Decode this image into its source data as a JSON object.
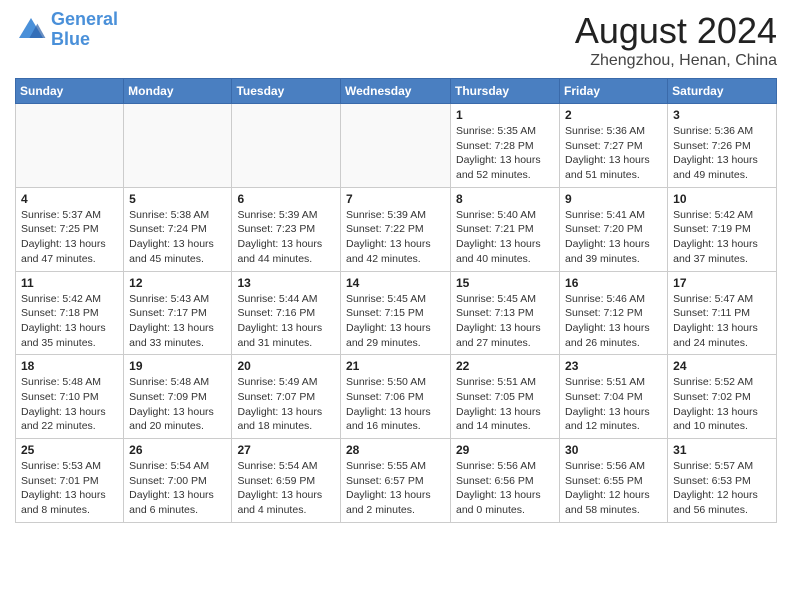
{
  "logo": {
    "line1": "General",
    "line2": "Blue"
  },
  "title": "August 2024",
  "subtitle": "Zhengzhou, Henan, China",
  "days_of_week": [
    "Sunday",
    "Monday",
    "Tuesday",
    "Wednesday",
    "Thursday",
    "Friday",
    "Saturday"
  ],
  "weeks": [
    [
      {
        "day": "",
        "info": ""
      },
      {
        "day": "",
        "info": ""
      },
      {
        "day": "",
        "info": ""
      },
      {
        "day": "",
        "info": ""
      },
      {
        "day": "1",
        "info": "Sunrise: 5:35 AM\nSunset: 7:28 PM\nDaylight: 13 hours\nand 52 minutes."
      },
      {
        "day": "2",
        "info": "Sunrise: 5:36 AM\nSunset: 7:27 PM\nDaylight: 13 hours\nand 51 minutes."
      },
      {
        "day": "3",
        "info": "Sunrise: 5:36 AM\nSunset: 7:26 PM\nDaylight: 13 hours\nand 49 minutes."
      }
    ],
    [
      {
        "day": "4",
        "info": "Sunrise: 5:37 AM\nSunset: 7:25 PM\nDaylight: 13 hours\nand 47 minutes."
      },
      {
        "day": "5",
        "info": "Sunrise: 5:38 AM\nSunset: 7:24 PM\nDaylight: 13 hours\nand 45 minutes."
      },
      {
        "day": "6",
        "info": "Sunrise: 5:39 AM\nSunset: 7:23 PM\nDaylight: 13 hours\nand 44 minutes."
      },
      {
        "day": "7",
        "info": "Sunrise: 5:39 AM\nSunset: 7:22 PM\nDaylight: 13 hours\nand 42 minutes."
      },
      {
        "day": "8",
        "info": "Sunrise: 5:40 AM\nSunset: 7:21 PM\nDaylight: 13 hours\nand 40 minutes."
      },
      {
        "day": "9",
        "info": "Sunrise: 5:41 AM\nSunset: 7:20 PM\nDaylight: 13 hours\nand 39 minutes."
      },
      {
        "day": "10",
        "info": "Sunrise: 5:42 AM\nSunset: 7:19 PM\nDaylight: 13 hours\nand 37 minutes."
      }
    ],
    [
      {
        "day": "11",
        "info": "Sunrise: 5:42 AM\nSunset: 7:18 PM\nDaylight: 13 hours\nand 35 minutes."
      },
      {
        "day": "12",
        "info": "Sunrise: 5:43 AM\nSunset: 7:17 PM\nDaylight: 13 hours\nand 33 minutes."
      },
      {
        "day": "13",
        "info": "Sunrise: 5:44 AM\nSunset: 7:16 PM\nDaylight: 13 hours\nand 31 minutes."
      },
      {
        "day": "14",
        "info": "Sunrise: 5:45 AM\nSunset: 7:15 PM\nDaylight: 13 hours\nand 29 minutes."
      },
      {
        "day": "15",
        "info": "Sunrise: 5:45 AM\nSunset: 7:13 PM\nDaylight: 13 hours\nand 27 minutes."
      },
      {
        "day": "16",
        "info": "Sunrise: 5:46 AM\nSunset: 7:12 PM\nDaylight: 13 hours\nand 26 minutes."
      },
      {
        "day": "17",
        "info": "Sunrise: 5:47 AM\nSunset: 7:11 PM\nDaylight: 13 hours\nand 24 minutes."
      }
    ],
    [
      {
        "day": "18",
        "info": "Sunrise: 5:48 AM\nSunset: 7:10 PM\nDaylight: 13 hours\nand 22 minutes."
      },
      {
        "day": "19",
        "info": "Sunrise: 5:48 AM\nSunset: 7:09 PM\nDaylight: 13 hours\nand 20 minutes."
      },
      {
        "day": "20",
        "info": "Sunrise: 5:49 AM\nSunset: 7:07 PM\nDaylight: 13 hours\nand 18 minutes."
      },
      {
        "day": "21",
        "info": "Sunrise: 5:50 AM\nSunset: 7:06 PM\nDaylight: 13 hours\nand 16 minutes."
      },
      {
        "day": "22",
        "info": "Sunrise: 5:51 AM\nSunset: 7:05 PM\nDaylight: 13 hours\nand 14 minutes."
      },
      {
        "day": "23",
        "info": "Sunrise: 5:51 AM\nSunset: 7:04 PM\nDaylight: 13 hours\nand 12 minutes."
      },
      {
        "day": "24",
        "info": "Sunrise: 5:52 AM\nSunset: 7:02 PM\nDaylight: 13 hours\nand 10 minutes."
      }
    ],
    [
      {
        "day": "25",
        "info": "Sunrise: 5:53 AM\nSunset: 7:01 PM\nDaylight: 13 hours\nand 8 minutes."
      },
      {
        "day": "26",
        "info": "Sunrise: 5:54 AM\nSunset: 7:00 PM\nDaylight: 13 hours\nand 6 minutes."
      },
      {
        "day": "27",
        "info": "Sunrise: 5:54 AM\nSunset: 6:59 PM\nDaylight: 13 hours\nand 4 minutes."
      },
      {
        "day": "28",
        "info": "Sunrise: 5:55 AM\nSunset: 6:57 PM\nDaylight: 13 hours\nand 2 minutes."
      },
      {
        "day": "29",
        "info": "Sunrise: 5:56 AM\nSunset: 6:56 PM\nDaylight: 13 hours\nand 0 minutes."
      },
      {
        "day": "30",
        "info": "Sunrise: 5:56 AM\nSunset: 6:55 PM\nDaylight: 12 hours\nand 58 minutes."
      },
      {
        "day": "31",
        "info": "Sunrise: 5:57 AM\nSunset: 6:53 PM\nDaylight: 12 hours\nand 56 minutes."
      }
    ]
  ]
}
